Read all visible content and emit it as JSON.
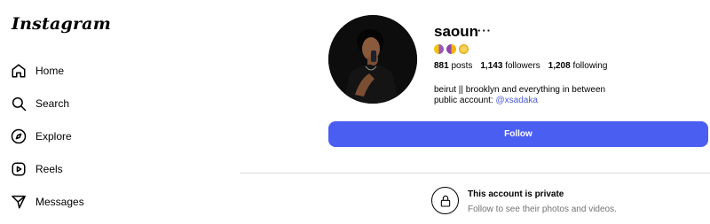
{
  "app": {
    "logo_text": "Instagram"
  },
  "sidebar": {
    "items": [
      {
        "label": "Home",
        "icon": "home-icon"
      },
      {
        "label": "Search",
        "icon": "search-icon"
      },
      {
        "label": "Explore",
        "icon": "compass-icon"
      },
      {
        "label": "Reels",
        "icon": "reels-icon"
      },
      {
        "label": "Messages",
        "icon": "messages-icon"
      }
    ]
  },
  "profile": {
    "username": "saoun",
    "more_label": "···",
    "stats": {
      "posts_count": "881",
      "posts_label": "posts",
      "followers_count": "1,143",
      "followers_label": "followers",
      "following_count": "1,208",
      "following_label": "following"
    },
    "bio_line1": "beirut || brooklyn and everything in between",
    "bio_line2_prefix": "public account:",
    "bio_link": "@xsadaka",
    "follow_label": "Follow"
  },
  "private_notice": {
    "title": "This account is private",
    "subtitle": "Follow to see their photos and videos."
  },
  "colors": {
    "accent": "#4b5ef2",
    "link": "#4a5ad6",
    "secondary_text": "#737373",
    "divider": "#dbdbdb"
  }
}
